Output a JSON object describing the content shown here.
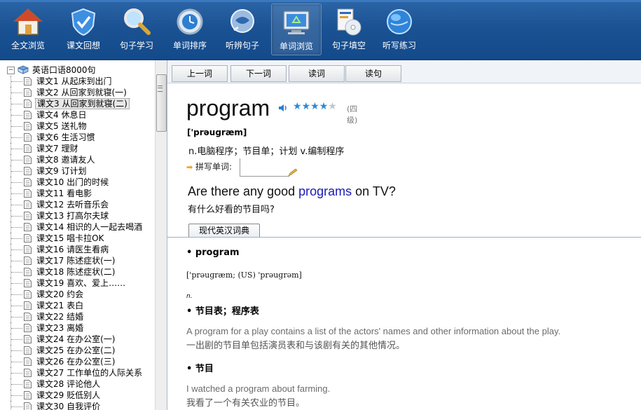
{
  "toolbar": {
    "items": [
      {
        "label": "全文浏览",
        "icon": "home-icon"
      },
      {
        "label": "课文回想",
        "icon": "shield-check-icon"
      },
      {
        "label": "句子学习",
        "icon": "magnifier-icon"
      },
      {
        "label": "单词排序",
        "icon": "clock-globe-icon"
      },
      {
        "label": "听辨句子",
        "icon": "speech-bubble-icon"
      },
      {
        "label": "单词浏览",
        "icon": "monitor-recycle-icon"
      },
      {
        "label": "句子填空",
        "icon": "cd-document-icon"
      },
      {
        "label": "听写练习",
        "icon": "globe-icon"
      }
    ],
    "active_index": 5
  },
  "tree": {
    "root": "英语口语8000句",
    "lessons": [
      "课文1 从起床到出门",
      "课文2 从回家到就寝(一)",
      "课文3 从回家到就寝(二)",
      "课文4 休息日",
      "课文5 送礼物",
      "课文6 生活习惯",
      "课文7 理财",
      "课文8 邀请友人",
      "课文9 订计划",
      "课文10 出门的时候",
      "课文11 看电影",
      "课文12 去听音乐会",
      "课文13 打高尔夫球",
      "课文14 相识的人一起去喝酒",
      "课文15 唱卡拉OK",
      "课文16 请医生看病",
      "课文17 陈述症状(一)",
      "课文18 陈述症状(二)",
      "课文19 喜欢、爱上……",
      "课文20 约会",
      "课文21 表白",
      "课文22 结婚",
      "课文23 离婚",
      "课文24 在办公室(一)",
      "课文25 在办公室(二)",
      "课文26 在办公室(三)",
      "课文27 工作单位的人际关系",
      "课文28 评论他人",
      "课文29 贬低别人",
      "课文30 自我评价"
    ],
    "selected_index": 2
  },
  "nav": {
    "prev": "上一词",
    "next": "下一词",
    "read_word": "读词",
    "read_sentence": "读句"
  },
  "word": {
    "headword": "program",
    "stars_filled": 4,
    "stars_total": 5,
    "level": "(四级)",
    "phonetic": "['prəugræm]",
    "definition": "n.电脑程序；节目单；计划 v.编制程序",
    "spell_label": "拼写单词:",
    "example_pre": "Are there any good ",
    "example_kw": "programs",
    "example_post": " on TV?",
    "example_zh": "有什么好看的节目吗?"
  },
  "dict": {
    "tab": "现代英汉词典",
    "entry_word": "• program",
    "entry_phonetic": "['prəuɡræm; (US) 'prəuɡrəm]",
    "pos": "n.",
    "sense1": "• 节目表；程序表",
    "ex1_en": "A program for a play contains a list of the actors' names and other information about the play.",
    "ex1_zh": "一出剧的节目单包括演员表和与该剧有关的其他情况。",
    "sense2": "• 节目",
    "ex2_en": "I watched a program about farming.",
    "ex2_zh": "我看了一个有关农业的节目。"
  },
  "colors": {
    "toolbar_bg": "#1b5293",
    "keyword": "#1a1ab4",
    "star": "#2a8ad8"
  }
}
